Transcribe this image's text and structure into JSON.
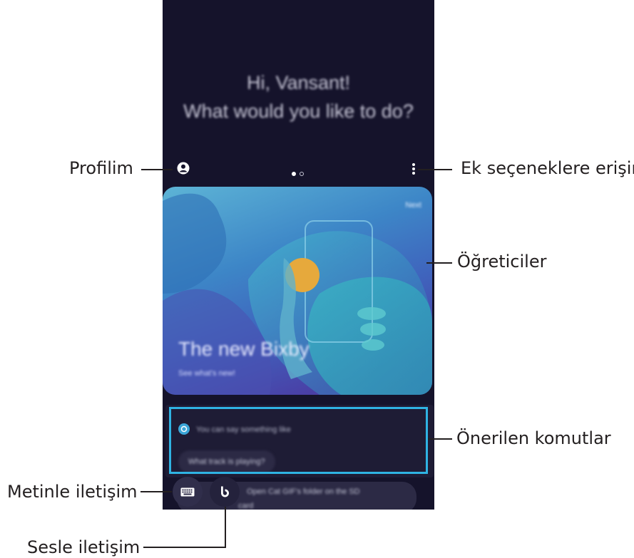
{
  "screen": {
    "greeting_line1": "Hi, Vansant!",
    "greeting_line2": "What would you like to do?"
  },
  "tutorial_card": {
    "next_label": "Next",
    "title": "The new Bixby",
    "subtitle": "See what's new!"
  },
  "suggestions": {
    "header": "You can say something like",
    "chip1": "What track is playing?",
    "chip2_line1": "Open Cat GIF's folder on the SD",
    "chip2_line2": "card"
  },
  "callouts": {
    "profile": "Profilim",
    "more_options": "Ek seçeneklere erişin",
    "tutorials": "Öğreticiler",
    "suggested_commands": "Önerilen komutlar",
    "text_input": "Metinle iletişim",
    "voice_input": "Sesle iletişim"
  },
  "icons": {
    "profile": "profile-icon",
    "more": "more-options-icon",
    "keyboard": "keyboard-icon",
    "bixby": "bixby-icon"
  },
  "colors": {
    "screen_bg": "#15132b",
    "highlight": "#2fb3e3"
  }
}
